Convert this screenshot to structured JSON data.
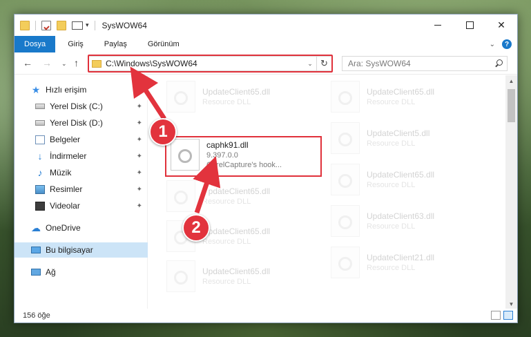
{
  "window": {
    "title": "SysWOW64",
    "controls": {
      "minimize": "minimize",
      "maximize": "maximize",
      "close": "✕"
    }
  },
  "ribbon": {
    "tabs": [
      {
        "label": "Dosya",
        "active": true
      },
      {
        "label": "Giriş"
      },
      {
        "label": "Paylaş"
      },
      {
        "label": "Görünüm"
      }
    ],
    "collapse_glyph": "⌄",
    "help_glyph": "?"
  },
  "nav": {
    "back": "←",
    "forward": "→",
    "recent": "⌄",
    "up": "↑",
    "address": "C:\\Windows\\SysWOW64",
    "address_drop": "⌄",
    "refresh": "↻",
    "search_placeholder": "Ara: SysWOW64"
  },
  "sidebar": {
    "items": [
      {
        "label": "Hızlı erişim",
        "icon": "star-icon"
      },
      {
        "label": "Yerel Disk (C:)",
        "icon": "drive-icon",
        "pinned": true
      },
      {
        "label": "Yerel Disk (D:)",
        "icon": "drive-icon",
        "pinned": true
      },
      {
        "label": "Belgeler",
        "icon": "documents-icon",
        "pinned": true
      },
      {
        "label": "İndirmeler",
        "icon": "downloads-icon",
        "pinned": true
      },
      {
        "label": "Müzik",
        "icon": "music-icon",
        "pinned": true
      },
      {
        "label": "Resimler",
        "icon": "pictures-icon",
        "pinned": true
      },
      {
        "label": "Videolar",
        "icon": "videos-icon",
        "pinned": true
      },
      {
        "label": "OneDrive",
        "icon": "onedrive-icon"
      },
      {
        "label": "Bu bilgisayar",
        "icon": "this-pc-icon",
        "selected": true
      },
      {
        "label": "Ağ",
        "icon": "network-icon"
      }
    ],
    "pin_glyph": "📌"
  },
  "files": {
    "left": [
      {
        "name": "UpdateClient65.dll",
        "sub": "Resource DLL"
      },
      {
        "name": "UpdateClient65.dll",
        "sub": "Resource DLL"
      },
      {
        "name": "UpdateClient65.dll",
        "sub": "Resource DLL"
      },
      {
        "name": "UpdateClient65.dll",
        "sub": "Resource DLL"
      }
    ],
    "right": [
      {
        "name": "UpdateClient65.dll",
        "sub": "Resource DLL"
      },
      {
        "name": "UpdateClient5.dll",
        "sub": "Resource DLL"
      },
      {
        "name": "UpdateClient65.dll",
        "sub": "Resource DLL"
      },
      {
        "name": "UpdateClient63.dll",
        "sub": "Resource DLL"
      },
      {
        "name": "UpdateClient21.dll",
        "sub": "Resource DLL"
      }
    ],
    "focus": {
      "name": "caphk91.dll",
      "version": "9.397.0.0",
      "description": "CorelCapture's hook..."
    }
  },
  "status": {
    "count": "156 öğe"
  },
  "annotations": {
    "step1": "1",
    "step2": "2",
    "accent": "#e2333d"
  }
}
